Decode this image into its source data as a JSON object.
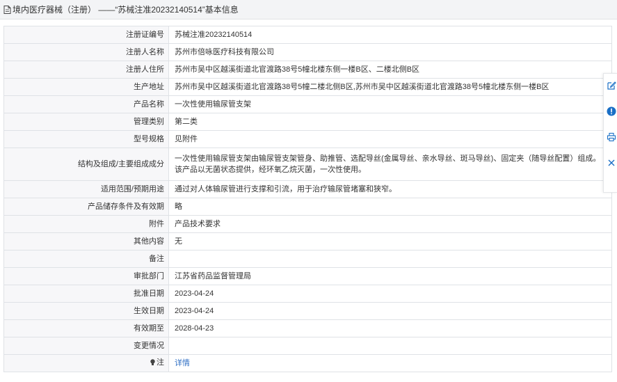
{
  "header": {
    "title": "境内医疗器械（注册） ——“苏械注准20232140514”基本信息",
    "icon": "document-icon"
  },
  "rows": [
    {
      "label": "注册证编号",
      "value": "苏械注准20232140514"
    },
    {
      "label": "注册人名称",
      "value": "苏州市倍咏医疗科技有限公司"
    },
    {
      "label": "注册人住所",
      "value": "苏州市吴中区越溪街道北官渡路38号5幢北楼东侧一楼B区、二楼北侧B区"
    },
    {
      "label": "生产地址",
      "value": "苏州市吴中区越溪街道北官渡路38号5幢二楼北侧B区,苏州市吴中区越溪街道北官渡路38号5幢北楼东侧一楼B区"
    },
    {
      "label": "产品名称",
      "value": "一次性使用输尿管支架"
    },
    {
      "label": "管理类别",
      "value": "第二类"
    },
    {
      "label": "型号规格",
      "value": "见附件"
    },
    {
      "label": "结构及组成/主要组成成分",
      "value": "一次性使用输尿管支架由输尿管支架管身、助推管、选配导丝(金属导丝、亲水导丝、斑马导丝)、固定夹（随导丝配置）组成。该产品以无菌状态提供，经环氧乙烷灭菌，一次性使用。"
    },
    {
      "label": "适用范围/预期用途",
      "value": "通过对人体输尿管进行支撑和引流，用于治疗输尿管堵塞和狭窄。"
    },
    {
      "label": "产品储存条件及有效期",
      "value": "略"
    },
    {
      "label": "附件",
      "value": "产品技术要求"
    },
    {
      "label": "其他内容",
      "value": "无"
    },
    {
      "label": "备注",
      "value": ""
    },
    {
      "label": "审批部门",
      "value": "江苏省药品监督管理局"
    },
    {
      "label": "批准日期",
      "value": "2023-04-24"
    },
    {
      "label": "生效日期",
      "value": "2023-04-24"
    },
    {
      "label": "有效期至",
      "value": "2028-04-23"
    },
    {
      "label": "变更情况",
      "value": ""
    }
  ],
  "note": {
    "label": "注",
    "link_text": "详情",
    "icon": "lightbulb-icon"
  },
  "side_toolbar": {
    "buttons": [
      "edit-icon",
      "info-icon",
      "print-icon",
      "close-icon"
    ]
  },
  "colors": {
    "header_bg": "#f3f4f6",
    "label_bg": "#f7f7f9",
    "border": "#dfe2e6",
    "link": "#2f6fc4",
    "toolbar_icon": "#1a6fc6"
  }
}
